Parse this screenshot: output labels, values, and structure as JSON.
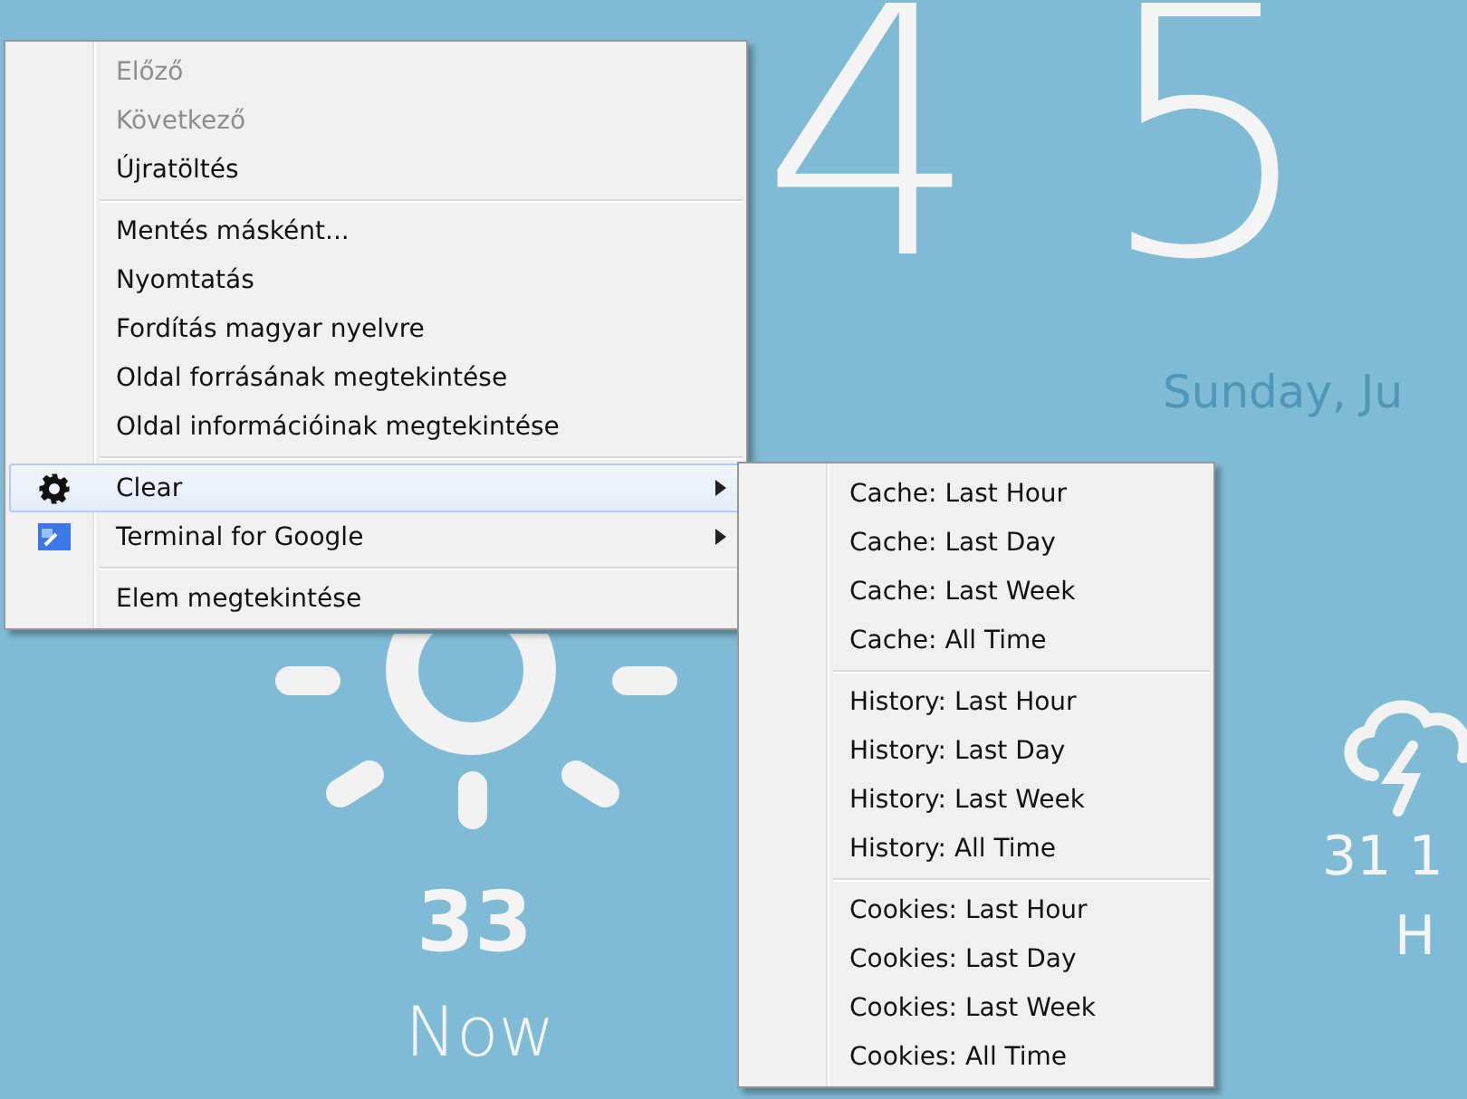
{
  "clock": {
    "hour_digit": "4",
    "minute_digit": "5"
  },
  "date": "Sunday, Ju",
  "now": {
    "temperature": "33",
    "label": "Now"
  },
  "forecast": {
    "temperature": "31 1",
    "label": "H"
  },
  "context_menu": {
    "groups": [
      {
        "items": [
          {
            "label": "Előző",
            "kind": "text",
            "disabled": true,
            "selected": false,
            "has_submenu": false
          },
          {
            "label": "Következő",
            "kind": "text",
            "disabled": true,
            "selected": false,
            "has_submenu": false
          },
          {
            "label": "Újratöltés",
            "kind": "text",
            "disabled": false,
            "selected": false,
            "has_submenu": false
          }
        ]
      },
      {
        "items": [
          {
            "label": "Mentés másként...",
            "kind": "text",
            "disabled": false,
            "selected": false,
            "has_submenu": false
          },
          {
            "label": "Nyomtatás",
            "kind": "text",
            "disabled": false,
            "selected": false,
            "has_submenu": false
          },
          {
            "label": "Fordítás magyar nyelvre",
            "kind": "text",
            "disabled": false,
            "selected": false,
            "has_submenu": false
          },
          {
            "label": "Oldal forrásának megtekintése",
            "kind": "text",
            "disabled": false,
            "selected": false,
            "has_submenu": false
          },
          {
            "label": "Oldal információinak megtekintése",
            "kind": "text",
            "disabled": false,
            "selected": false,
            "has_submenu": false
          }
        ]
      },
      {
        "items": [
          {
            "label": "Clear",
            "kind": "gear",
            "disabled": false,
            "selected": true,
            "has_submenu": true
          },
          {
            "label": "Terminal for Google",
            "kind": "app",
            "disabled": false,
            "selected": false,
            "has_submenu": true
          }
        ]
      },
      {
        "items": [
          {
            "label": "Elem megtekintése",
            "kind": "text",
            "disabled": false,
            "selected": false,
            "has_submenu": false
          }
        ]
      }
    ]
  },
  "submenu": {
    "groups": [
      {
        "items": [
          {
            "label": "Cache: Last Hour"
          },
          {
            "label": "Cache: Last Day"
          },
          {
            "label": "Cache: Last Week"
          },
          {
            "label": "Cache: All Time"
          }
        ]
      },
      {
        "items": [
          {
            "label": "History: Last Hour"
          },
          {
            "label": "History: Last Day"
          },
          {
            "label": "History: Last Week"
          },
          {
            "label": "History: All Time"
          }
        ]
      },
      {
        "items": [
          {
            "label": "Cookies: Last Hour"
          },
          {
            "label": "Cookies: Last Day"
          },
          {
            "label": "Cookies: Last Week"
          },
          {
            "label": "Cookies: All Time"
          }
        ]
      }
    ]
  }
}
